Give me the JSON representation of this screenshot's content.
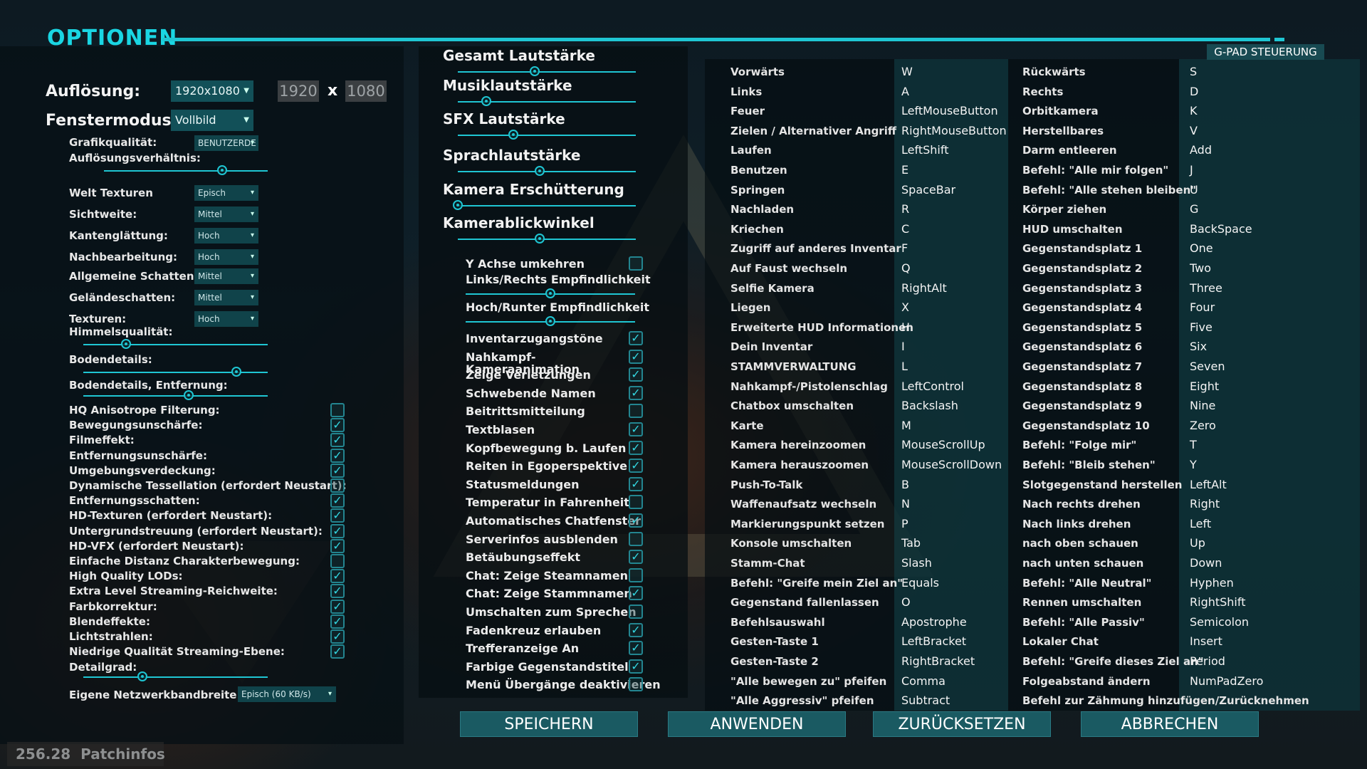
{
  "header": {
    "title": "OPTIONEN",
    "gpad_tab": "G-PAD STEUERUNG"
  },
  "left": {
    "resolution": {
      "label": "Auflösung:",
      "value": "1920x1080",
      "width": "1920",
      "x": "x",
      "height": "1080"
    },
    "window_mode": {
      "label": "Fenstermodus:",
      "value": "Vollbild"
    },
    "graphics_quality": {
      "label": "Grafikqualität:",
      "value": "BENUTZERDE"
    },
    "resolution_scale": {
      "label": "Auflösungsverhältnis:",
      "level": 0.72
    },
    "dropdowns": [
      {
        "label": "Welt Texturen",
        "value": "Episch"
      },
      {
        "label": "Sichtweite:",
        "value": "Mittel"
      },
      {
        "label": "Kantenglättung:",
        "value": "Hoch"
      },
      {
        "label": "Nachbearbeitung:",
        "value": "Hoch"
      },
      {
        "label": "Allgemeine Schatten:",
        "value": "Mittel"
      },
      {
        "label": "Geländeschatten:",
        "value": "Mittel"
      },
      {
        "label": "Texturen:",
        "value": "Hoch"
      }
    ],
    "sky_quality": {
      "label": "Himmelsqualität:",
      "level": 0.23
    },
    "ground_detail": {
      "label": "Bodendetails:",
      "level": 0.83
    },
    "ground_detail_distance": {
      "label": "Bodendetails, Entfernung:",
      "level": 0.57
    },
    "checkboxes": [
      {
        "label": "HQ Anisotrope Filterung:",
        "checked": false
      },
      {
        "label": "Bewegungsunschärfe:",
        "checked": true
      },
      {
        "label": "Filmeffekt:",
        "checked": true
      },
      {
        "label": "Entfernungsunschärfe:",
        "checked": true
      },
      {
        "label": "Umgebungsverdeckung:",
        "checked": true
      },
      {
        "label": "Dynamische Tessellation (erfordert Neustart):",
        "checked": false
      },
      {
        "label": "Entfernungsschatten:",
        "checked": true
      },
      {
        "label": "HD-Texturen (erfordert Neustart):",
        "checked": true
      },
      {
        "label": "Untergrundstreuung (erfordert Neustart):",
        "checked": true
      },
      {
        "label": "HD-VFX (erfordert Neustart):",
        "checked": true
      },
      {
        "label": "Einfache Distanz Charakterbewegung:",
        "checked": false
      },
      {
        "label": "High Quality LODs:",
        "checked": true
      },
      {
        "label": "Extra Level Streaming-Reichweite:",
        "checked": true
      },
      {
        "label": "Farbkorrektur:",
        "checked": true
      },
      {
        "label": "Blendeffekte:",
        "checked": true
      },
      {
        "label": "Lichtstrahlen:",
        "checked": true
      },
      {
        "label": "Niedrige Qualität Streaming-Ebene:",
        "checked": true
      }
    ],
    "detail": {
      "label": "Detailgrad:",
      "level": 0.32
    },
    "bandwidth": {
      "label": "Eigene Netzwerkbandbreite:",
      "value": "Episch (60 KB/s)"
    }
  },
  "middle": {
    "sliders": [
      {
        "label": "Gesamt Lautstärke",
        "level": 0.43
      },
      {
        "label": "Musiklautstärke",
        "level": 0.16
      },
      {
        "label": "SFX Lautstärke",
        "level": 0.31
      },
      {
        "label": "Sprachlautstärke",
        "level": 0.46
      },
      {
        "label": "Kamera Erschütterung",
        "level": 0.0
      },
      {
        "label": "Kamerablickwinkel",
        "level": 0.46
      }
    ],
    "invert_y": {
      "label": "Y Achse umkehren",
      "checked": false
    },
    "sens_lr": {
      "label": "Links/Rechts Empfindlichkeit",
      "level": 0.5
    },
    "sens_ud": {
      "label": "Hoch/Runter Empfindlichkeit",
      "level": 0.5
    },
    "checkboxes": [
      {
        "label": "Inventarzugangstöne",
        "checked": true
      },
      {
        "label": "Nahkampf-",
        "checked": true
      },
      {
        "label": "Zeige Verletzungen",
        "checked": true
      },
      {
        "label": "Schwebende Namen",
        "checked": true
      },
      {
        "label": "Beitrittsmitteilung",
        "checked": false
      },
      {
        "label": "Textblasen",
        "checked": true
      },
      {
        "label": "Kopfbewegung b. Laufen",
        "checked": true
      },
      {
        "label": "Reiten in Egoperspektive",
        "checked": true
      },
      {
        "label": "Statusmeldungen",
        "checked": true
      },
      {
        "label": "Temperatur in Fahrenheit",
        "checked": false
      },
      {
        "label": "Automatisches Chatfenster",
        "checked": true
      },
      {
        "label": "Serverinfos ausblenden",
        "checked": false
      },
      {
        "label": "Betäubungseffekt",
        "checked": true
      },
      {
        "label": "Chat: Zeige Steamnamen",
        "checked": false
      },
      {
        "label": "Chat: Zeige Stammnamen",
        "checked": true
      },
      {
        "label": "Umschalten zum Sprechen",
        "checked": false
      },
      {
        "label": "Fadenkreuz erlauben",
        "checked": true
      },
      {
        "label": "Trefferanzeige An",
        "checked": true
      },
      {
        "label": "Farbige Gegenstandstitel",
        "checked": true
      },
      {
        "label": "Menü Übergänge deaktivieren",
        "checked": false
      }
    ],
    "overlap_label": "Kameraanimation"
  },
  "bindings1": [
    [
      "Vorwärts",
      "W"
    ],
    [
      "Links",
      "A"
    ],
    [
      "Feuer",
      "LeftMouseButton"
    ],
    [
      "Zielen / Alternativer Angriff",
      "RightMouseButton"
    ],
    [
      "Laufen",
      "LeftShift"
    ],
    [
      "Benutzen",
      "E"
    ],
    [
      "Springen",
      "SpaceBar"
    ],
    [
      "Nachladen",
      "R"
    ],
    [
      "Kriechen",
      "C"
    ],
    [
      "Zugriff auf anderes Inventar",
      "F"
    ],
    [
      "Auf Faust wechseln",
      "Q"
    ],
    [
      "Selfie Kamera",
      "RightAlt"
    ],
    [
      "Liegen",
      "X"
    ],
    [
      "Erweiterte HUD Informationen",
      "H"
    ],
    [
      "Dein Inventar",
      "I"
    ],
    [
      "STAMMVERWALTUNG",
      "L"
    ],
    [
      "Nahkampf-/Pistolenschlag",
      "LeftControl"
    ],
    [
      "Chatbox umschalten",
      "Backslash"
    ],
    [
      "Karte",
      "M"
    ],
    [
      "Kamera hereinzoomen",
      "MouseScrollUp"
    ],
    [
      "Kamera herauszoomen",
      "MouseScrollDown"
    ],
    [
      "Push-To-Talk",
      "B"
    ],
    [
      "Waffenaufsatz wechseln",
      "N"
    ],
    [
      "Markierungspunkt setzen",
      "P"
    ],
    [
      "Konsole umschalten",
      "Tab"
    ],
    [
      "Stamm-Chat",
      "Slash"
    ],
    [
      "Befehl: \"Greife mein Ziel an\"",
      "Equals"
    ],
    [
      "Gegenstand fallenlassen",
      "O"
    ],
    [
      "Befehlsauswahl",
      "Apostrophe"
    ],
    [
      "Gesten-Taste 1",
      "LeftBracket"
    ],
    [
      "Gesten-Taste 2",
      "RightBracket"
    ],
    [
      "\"Alle bewegen zu\" pfeifen",
      "Comma"
    ],
    [
      "\"Alle Aggressiv\" pfeifen",
      "Subtract"
    ]
  ],
  "bindings2": [
    [
      "Rückwärts",
      "S"
    ],
    [
      "Rechts",
      "D"
    ],
    [
      "Orbitkamera",
      "K"
    ],
    [
      "Herstellbares",
      "V"
    ],
    [
      "Darm entleeren",
      "Add"
    ],
    [
      "Befehl: \"Alle mir folgen\"",
      "J"
    ],
    [
      "Befehl: \"Alle stehen bleiben\"",
      "U"
    ],
    [
      "Körper ziehen",
      "G"
    ],
    [
      "HUD umschalten",
      "BackSpace"
    ],
    [
      "Gegenstandsplatz 1",
      "One"
    ],
    [
      "Gegenstandsplatz 2",
      "Two"
    ],
    [
      "Gegenstandsplatz 3",
      "Three"
    ],
    [
      "Gegenstandsplatz 4",
      "Four"
    ],
    [
      "Gegenstandsplatz 5",
      "Five"
    ],
    [
      "Gegenstandsplatz 6",
      "Six"
    ],
    [
      "Gegenstandsplatz 7",
      "Seven"
    ],
    [
      "Gegenstandsplatz 8",
      "Eight"
    ],
    [
      "Gegenstandsplatz 9",
      "Nine"
    ],
    [
      "Gegenstandsplatz 10",
      "Zero"
    ],
    [
      "Befehl: \"Folge mir\"",
      "T"
    ],
    [
      "Befehl: \"Bleib stehen\"",
      "Y"
    ],
    [
      "Slotgegenstand herstellen",
      "LeftAlt"
    ],
    [
      "Nach rechts drehen",
      "Right"
    ],
    [
      "Nach links drehen",
      "Left"
    ],
    [
      "nach oben schauen",
      "Up"
    ],
    [
      "nach unten schauen",
      "Down"
    ],
    [
      "Befehl: \"Alle Neutral\"",
      "Hyphen"
    ],
    [
      "Rennen umschalten",
      "RightShift"
    ],
    [
      "Befehl: \"Alle Passiv\"",
      "Semicolon"
    ],
    [
      "Lokaler Chat",
      "Insert"
    ],
    [
      "Befehl: \"Greife dieses Ziel an\"",
      "Period"
    ],
    [
      "Folgeabstand ändern",
      "NumPadZero"
    ],
    [
      "Befehl zur Zähmung hinzufügen/Zurücknehmen",
      ""
    ]
  ],
  "buttons": {
    "save": "SPEICHERN",
    "apply": "ANWENDEN",
    "reset": "ZURÜCKSETZEN",
    "cancel": "ABBRECHEN"
  },
  "footer": {
    "version": "256.28",
    "patchnotes": "Patchinfos"
  }
}
